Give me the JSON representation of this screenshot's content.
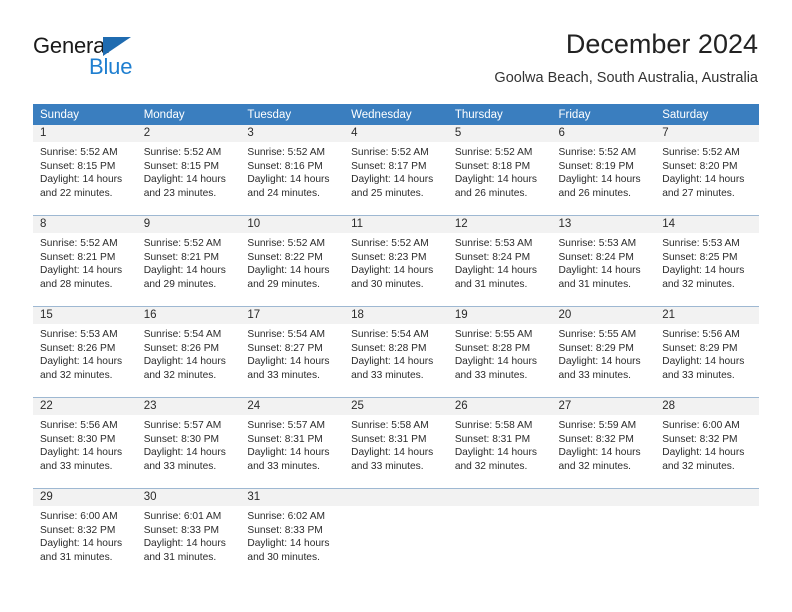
{
  "brand": {
    "name_part1": "General",
    "name_part2": "Blue",
    "triangle_color": "#1f6bb0",
    "blue_color": "#1f7fd0"
  },
  "header": {
    "title": "December 2024",
    "subtitle": "Goolwa Beach, South Australia, Australia"
  },
  "theme": {
    "header_bg": "#3a7ebf",
    "daynum_bg": "#f2f2f2",
    "row_divider": "#9eb8d2",
    "text": "#2b2b2b"
  },
  "weekdays": [
    "Sunday",
    "Monday",
    "Tuesday",
    "Wednesday",
    "Thursday",
    "Friday",
    "Saturday"
  ],
  "labels": {
    "sunrise_prefix": "Sunrise:",
    "sunset_prefix": "Sunset:",
    "daylight_prefix": "Daylight:"
  },
  "weeks": [
    [
      {
        "day": "1",
        "line1": "Sunrise: 5:52 AM",
        "line2": "Sunset: 8:15 PM",
        "line3": "Daylight: 14 hours",
        "line4": "and 22 minutes."
      },
      {
        "day": "2",
        "line1": "Sunrise: 5:52 AM",
        "line2": "Sunset: 8:15 PM",
        "line3": "Daylight: 14 hours",
        "line4": "and 23 minutes."
      },
      {
        "day": "3",
        "line1": "Sunrise: 5:52 AM",
        "line2": "Sunset: 8:16 PM",
        "line3": "Daylight: 14 hours",
        "line4": "and 24 minutes."
      },
      {
        "day": "4",
        "line1": "Sunrise: 5:52 AM",
        "line2": "Sunset: 8:17 PM",
        "line3": "Daylight: 14 hours",
        "line4": "and 25 minutes."
      },
      {
        "day": "5",
        "line1": "Sunrise: 5:52 AM",
        "line2": "Sunset: 8:18 PM",
        "line3": "Daylight: 14 hours",
        "line4": "and 26 minutes."
      },
      {
        "day": "6",
        "line1": "Sunrise: 5:52 AM",
        "line2": "Sunset: 8:19 PM",
        "line3": "Daylight: 14 hours",
        "line4": "and 26 minutes."
      },
      {
        "day": "7",
        "line1": "Sunrise: 5:52 AM",
        "line2": "Sunset: 8:20 PM",
        "line3": "Daylight: 14 hours",
        "line4": "and 27 minutes."
      }
    ],
    [
      {
        "day": "8",
        "line1": "Sunrise: 5:52 AM",
        "line2": "Sunset: 8:21 PM",
        "line3": "Daylight: 14 hours",
        "line4": "and 28 minutes."
      },
      {
        "day": "9",
        "line1": "Sunrise: 5:52 AM",
        "line2": "Sunset: 8:21 PM",
        "line3": "Daylight: 14 hours",
        "line4": "and 29 minutes."
      },
      {
        "day": "10",
        "line1": "Sunrise: 5:52 AM",
        "line2": "Sunset: 8:22 PM",
        "line3": "Daylight: 14 hours",
        "line4": "and 29 minutes."
      },
      {
        "day": "11",
        "line1": "Sunrise: 5:52 AM",
        "line2": "Sunset: 8:23 PM",
        "line3": "Daylight: 14 hours",
        "line4": "and 30 minutes."
      },
      {
        "day": "12",
        "line1": "Sunrise: 5:53 AM",
        "line2": "Sunset: 8:24 PM",
        "line3": "Daylight: 14 hours",
        "line4": "and 31 minutes."
      },
      {
        "day": "13",
        "line1": "Sunrise: 5:53 AM",
        "line2": "Sunset: 8:24 PM",
        "line3": "Daylight: 14 hours",
        "line4": "and 31 minutes."
      },
      {
        "day": "14",
        "line1": "Sunrise: 5:53 AM",
        "line2": "Sunset: 8:25 PM",
        "line3": "Daylight: 14 hours",
        "line4": "and 32 minutes."
      }
    ],
    [
      {
        "day": "15",
        "line1": "Sunrise: 5:53 AM",
        "line2": "Sunset: 8:26 PM",
        "line3": "Daylight: 14 hours",
        "line4": "and 32 minutes."
      },
      {
        "day": "16",
        "line1": "Sunrise: 5:54 AM",
        "line2": "Sunset: 8:26 PM",
        "line3": "Daylight: 14 hours",
        "line4": "and 32 minutes."
      },
      {
        "day": "17",
        "line1": "Sunrise: 5:54 AM",
        "line2": "Sunset: 8:27 PM",
        "line3": "Daylight: 14 hours",
        "line4": "and 33 minutes."
      },
      {
        "day": "18",
        "line1": "Sunrise: 5:54 AM",
        "line2": "Sunset: 8:28 PM",
        "line3": "Daylight: 14 hours",
        "line4": "and 33 minutes."
      },
      {
        "day": "19",
        "line1": "Sunrise: 5:55 AM",
        "line2": "Sunset: 8:28 PM",
        "line3": "Daylight: 14 hours",
        "line4": "and 33 minutes."
      },
      {
        "day": "20",
        "line1": "Sunrise: 5:55 AM",
        "line2": "Sunset: 8:29 PM",
        "line3": "Daylight: 14 hours",
        "line4": "and 33 minutes."
      },
      {
        "day": "21",
        "line1": "Sunrise: 5:56 AM",
        "line2": "Sunset: 8:29 PM",
        "line3": "Daylight: 14 hours",
        "line4": "and 33 minutes."
      }
    ],
    [
      {
        "day": "22",
        "line1": "Sunrise: 5:56 AM",
        "line2": "Sunset: 8:30 PM",
        "line3": "Daylight: 14 hours",
        "line4": "and 33 minutes."
      },
      {
        "day": "23",
        "line1": "Sunrise: 5:57 AM",
        "line2": "Sunset: 8:30 PM",
        "line3": "Daylight: 14 hours",
        "line4": "and 33 minutes."
      },
      {
        "day": "24",
        "line1": "Sunrise: 5:57 AM",
        "line2": "Sunset: 8:31 PM",
        "line3": "Daylight: 14 hours",
        "line4": "and 33 minutes."
      },
      {
        "day": "25",
        "line1": "Sunrise: 5:58 AM",
        "line2": "Sunset: 8:31 PM",
        "line3": "Daylight: 14 hours",
        "line4": "and 33 minutes."
      },
      {
        "day": "26",
        "line1": "Sunrise: 5:58 AM",
        "line2": "Sunset: 8:31 PM",
        "line3": "Daylight: 14 hours",
        "line4": "and 32 minutes."
      },
      {
        "day": "27",
        "line1": "Sunrise: 5:59 AM",
        "line2": "Sunset: 8:32 PM",
        "line3": "Daylight: 14 hours",
        "line4": "and 32 minutes."
      },
      {
        "day": "28",
        "line1": "Sunrise: 6:00 AM",
        "line2": "Sunset: 8:32 PM",
        "line3": "Daylight: 14 hours",
        "line4": "and 32 minutes."
      }
    ],
    [
      {
        "day": "29",
        "line1": "Sunrise: 6:00 AM",
        "line2": "Sunset: 8:32 PM",
        "line3": "Daylight: 14 hours",
        "line4": "and 31 minutes."
      },
      {
        "day": "30",
        "line1": "Sunrise: 6:01 AM",
        "line2": "Sunset: 8:33 PM",
        "line3": "Daylight: 14 hours",
        "line4": "and 31 minutes."
      },
      {
        "day": "31",
        "line1": "Sunrise: 6:02 AM",
        "line2": "Sunset: 8:33 PM",
        "line3": "Daylight: 14 hours",
        "line4": "and 30 minutes."
      },
      {
        "day": "",
        "line1": "",
        "line2": "",
        "line3": "",
        "line4": ""
      },
      {
        "day": "",
        "line1": "",
        "line2": "",
        "line3": "",
        "line4": ""
      },
      {
        "day": "",
        "line1": "",
        "line2": "",
        "line3": "",
        "line4": ""
      },
      {
        "day": "",
        "line1": "",
        "line2": "",
        "line3": "",
        "line4": ""
      }
    ]
  ]
}
